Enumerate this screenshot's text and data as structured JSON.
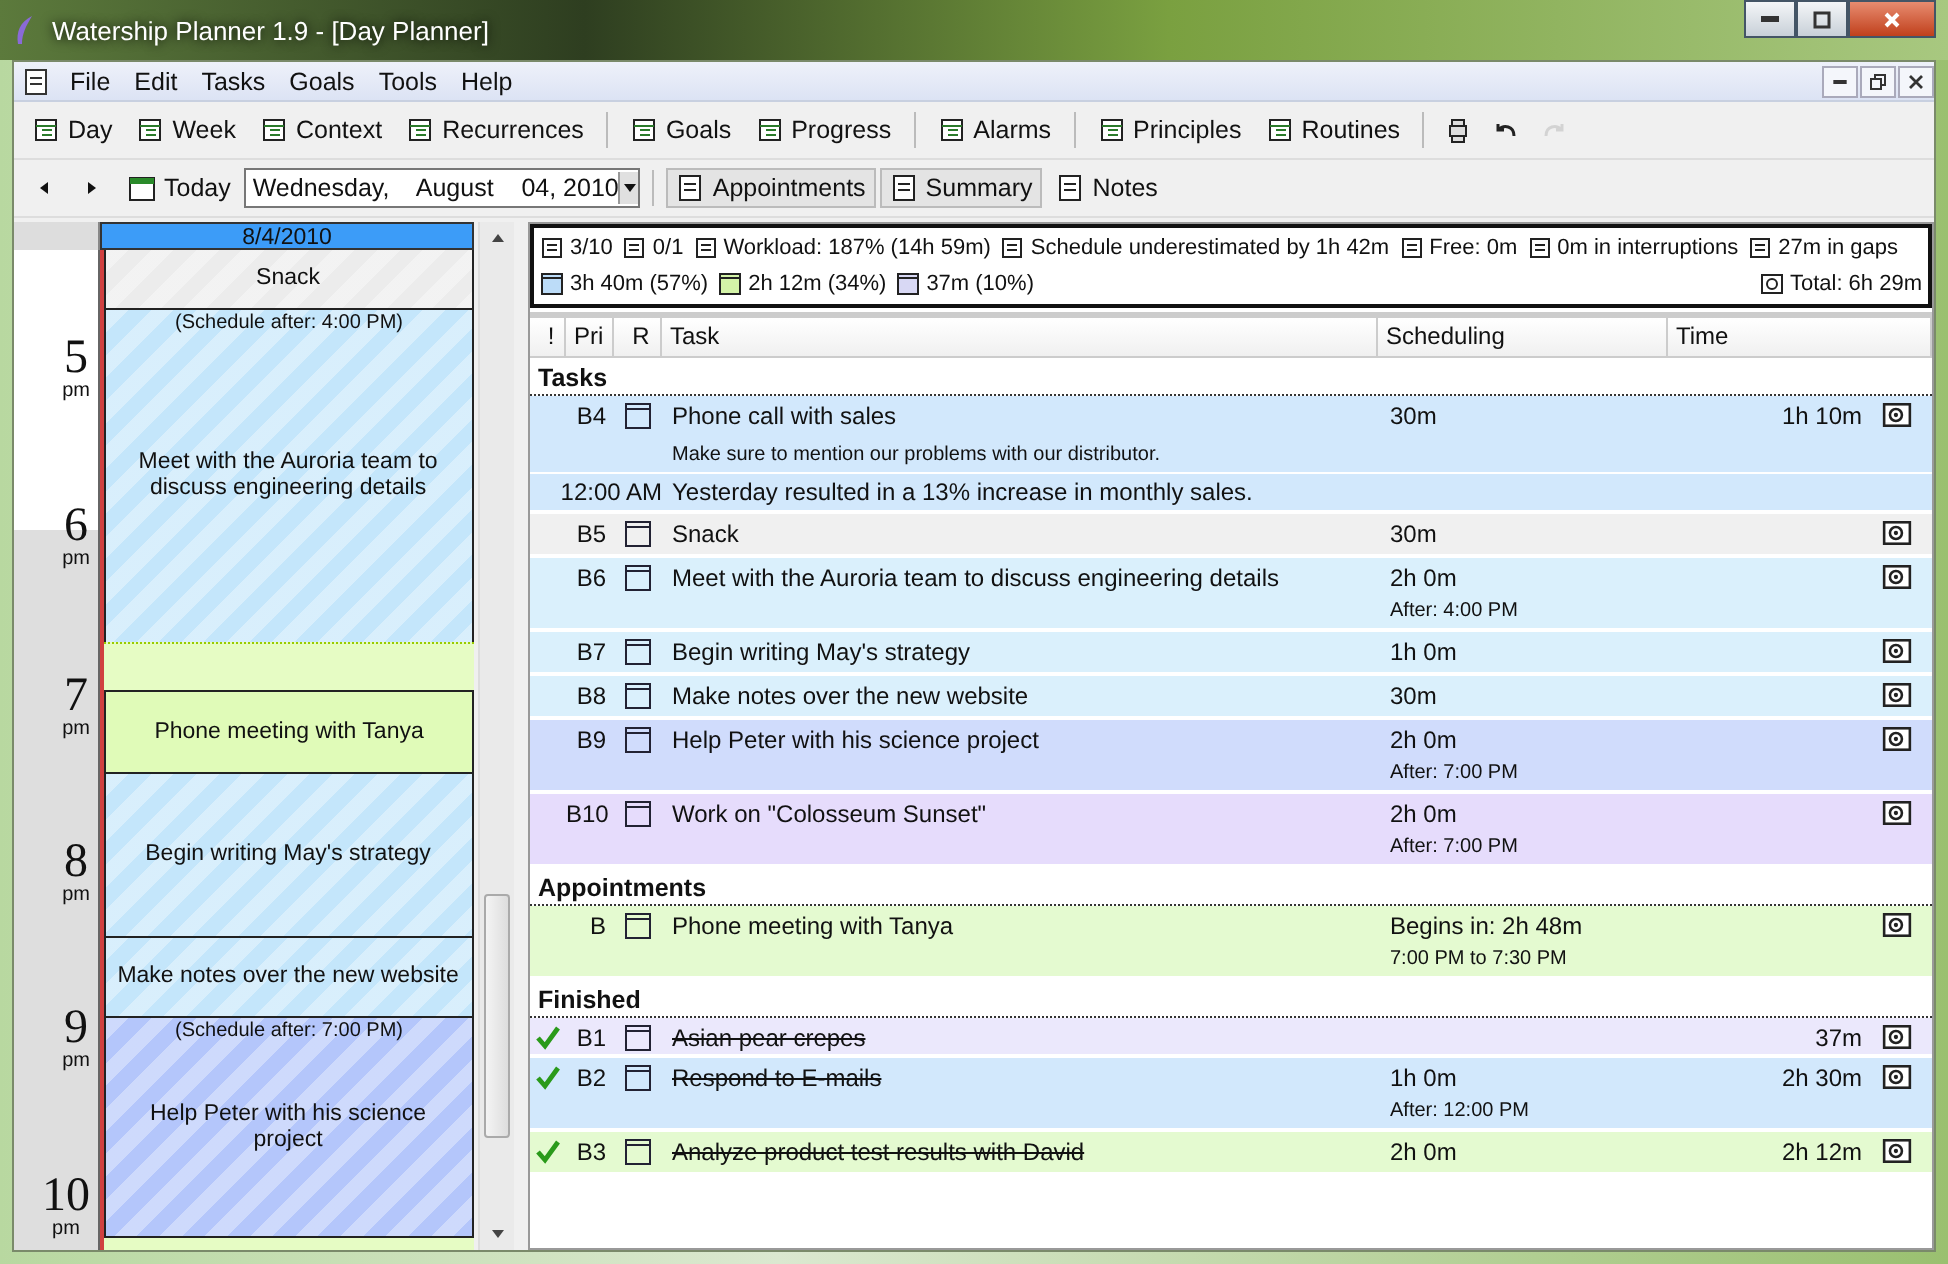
{
  "window": {
    "title": "Watership Planner 1.9 - [Day Planner]"
  },
  "menu": [
    "File",
    "Edit",
    "Tasks",
    "Goals",
    "Tools",
    "Help"
  ],
  "toolbar": [
    {
      "label": "Day",
      "kind": "button"
    },
    {
      "label": "Week",
      "kind": "button"
    },
    {
      "label": "Context",
      "kind": "button"
    },
    {
      "label": "Recurrences",
      "kind": "button"
    },
    {
      "kind": "separator"
    },
    {
      "label": "Goals",
      "kind": "button"
    },
    {
      "label": "Progress",
      "kind": "button"
    },
    {
      "kind": "separator"
    },
    {
      "label": "Alarms",
      "kind": "button"
    },
    {
      "kind": "separator"
    },
    {
      "label": "Principles",
      "kind": "button"
    },
    {
      "label": "Routines",
      "kind": "button"
    },
    {
      "kind": "separator"
    },
    {
      "kind": "icon",
      "disabled": false
    },
    {
      "kind": "icon",
      "disabled": false
    },
    {
      "kind": "icon",
      "disabled": true
    }
  ],
  "navbar": {
    "today": "Today",
    "date": "Wednesday,    August    04, 2010",
    "views": [
      {
        "label": "Appointments",
        "selected": true
      },
      {
        "label": "Summary",
        "selected": true
      },
      {
        "label": "Notes",
        "selected": false
      }
    ]
  },
  "day_view": {
    "date": "8/4/2010",
    "hours": [
      {
        "hour": "5",
        "period": "pm"
      },
      {
        "hour": "6",
        "period": "pm"
      },
      {
        "hour": "7",
        "period": "pm"
      },
      {
        "hour": "8",
        "period": "pm"
      },
      {
        "hour": "9",
        "period": "pm"
      },
      {
        "hour": "10",
        "period": "pm"
      }
    ],
    "blocks": [
      {
        "kind": "task",
        "title": "Snack",
        "color": "#ececec"
      },
      {
        "kind": "task",
        "title": "Meet with the Auroria team to discuss engineering details",
        "note": "(Schedule after: 4:00 PM)",
        "color": "#c4e6fb"
      },
      {
        "kind": "gap",
        "color": "#e6fcc4"
      },
      {
        "kind": "appointment",
        "title": "Phone meeting with Tanya",
        "color": "#e0fbb8"
      },
      {
        "kind": "task",
        "title": "Begin writing May's strategy",
        "color": "#c4e6fb"
      },
      {
        "kind": "task",
        "title": "Make notes over the new website",
        "color": "#c4e6fb"
      },
      {
        "kind": "task",
        "title": "Help Peter with his science project",
        "note": "(Schedule after: 7:00 PM)",
        "color": "#b4c6fb"
      }
    ]
  },
  "summary": {
    "stats": [
      "3/10",
      "0/1",
      "Workload: 187% (14h 59m)",
      "Schedule underestimated by 1h 42m",
      "Free: 0m",
      "0m in interruptions",
      "27m in gaps"
    ],
    "shares": [
      {
        "text": "3h 40m (57%)",
        "color": "#bcdcf8"
      },
      {
        "text": "2h 12m (34%)",
        "color": "#d4f4a8"
      },
      {
        "text": "37m (10%)",
        "color": "#d8d8f4"
      }
    ],
    "total": "Total: 6h 29m"
  },
  "table": {
    "columns": [
      "!",
      "Pri",
      "R",
      "Task",
      "Scheduling",
      "Time"
    ],
    "sections": [
      {
        "title": "Tasks",
        "rows": [
          {
            "done": false,
            "pri": "B4",
            "task": "Phone call with sales",
            "scheduling": "30m",
            "time": "1h 10m",
            "color": "#d2e8fc",
            "notes": [
              {
                "kind": "comment",
                "text": "Make sure to mention our problems with our distributor."
              },
              {
                "kind": "log",
                "time": "12:00 AM",
                "text": "Yesterday resulted in a 13% increase in monthly sales."
              }
            ]
          },
          {
            "done": false,
            "pri": "B5",
            "task": "Snack",
            "scheduling": "30m",
            "color": "#f0f0f0"
          },
          {
            "done": false,
            "pri": "B6",
            "task": "Meet with the Auroria team to discuss engineering details",
            "scheduling": "2h 0m",
            "scheduling_note": "After: 4:00 PM",
            "color": "#daf0fc"
          },
          {
            "done": false,
            "pri": "B7",
            "task": "Begin writing May's strategy",
            "scheduling": "1h 0m",
            "color": "#daf0fc"
          },
          {
            "done": false,
            "pri": "B8",
            "task": "Make notes over the new website",
            "scheduling": "30m",
            "color": "#daf0fc"
          },
          {
            "done": false,
            "pri": "B9",
            "task": "Help Peter with his science project",
            "scheduling": "2h 0m",
            "scheduling_note": "After: 7:00 PM",
            "color": "#d0dcfc"
          },
          {
            "done": false,
            "pri": "B10",
            "task": "Work on \"Colosseum Sunset\"",
            "scheduling": "2h 0m",
            "scheduling_note": "After: 7:00 PM",
            "color": "#e6dcfc"
          }
        ]
      },
      {
        "title": "Appointments",
        "rows": [
          {
            "done": false,
            "pri": "B",
            "task": "Phone meeting with Tanya",
            "scheduling": "Begins in: 2h 48m",
            "scheduling_note": "7:00 PM to 7:30 PM",
            "color": "#e4fad0"
          }
        ]
      },
      {
        "title": "Finished",
        "rows": [
          {
            "done": true,
            "pri": "B1",
            "task": "Asian pear crepes",
            "time": "37m",
            "color": "#ebe8fc"
          },
          {
            "done": true,
            "pri": "B2",
            "task": "Respond to E-mails",
            "scheduling": "1h 0m",
            "scheduling_note": "After: 12:00 PM",
            "time": "2h 30m",
            "color": "#d2e8fc"
          },
          {
            "done": true,
            "pri": "B3",
            "task": "Analyze product test results with David",
            "scheduling": "2h 0m",
            "time": "2h 12m",
            "color": "#e4fad0"
          }
        ]
      }
    ]
  }
}
